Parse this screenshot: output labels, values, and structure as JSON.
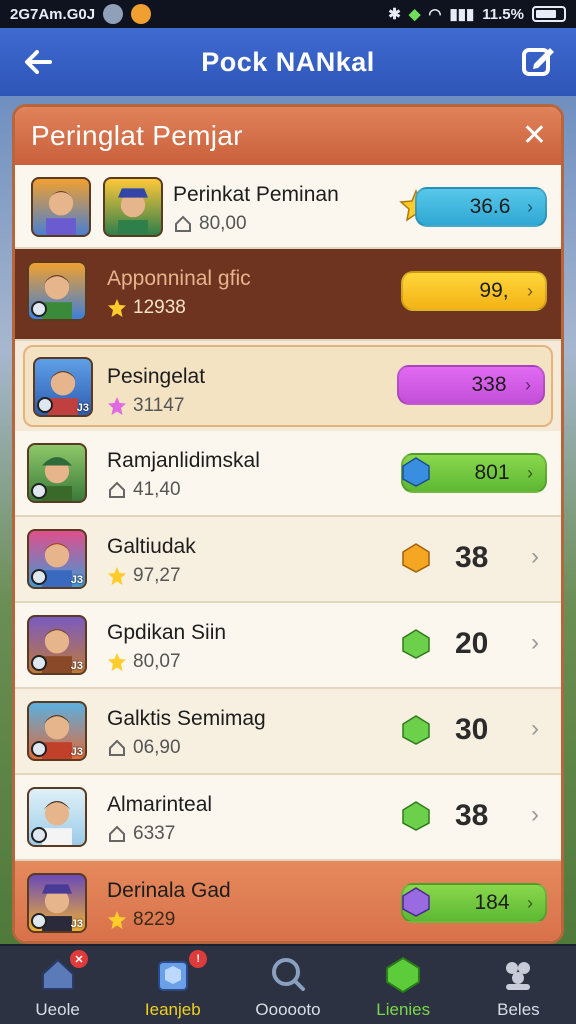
{
  "status_bar": {
    "time": "2G7Am.G0J",
    "battery": "11.5%"
  },
  "app_bar": {
    "title": "Pock NANkal"
  },
  "panel": {
    "title": "Peringlat Pemjar",
    "close": "✕"
  },
  "rows": [
    {
      "name": "Perinkat Peminan",
      "sub_value": "80,00",
      "sub_icon": "house-icon",
      "badge": "",
      "value": "36.6",
      "value_style": "pill-teal",
      "gem": "star-gem"
    },
    {
      "name": "Apponninal gfic",
      "sub_value": "12938",
      "sub_icon": "star-icon",
      "badge": "",
      "value": "99,",
      "value_style": "pill-yellow",
      "gem": "pink-gem"
    },
    {
      "name": "Pesingelat",
      "sub_value": "31147",
      "sub_icon": "pink-star-icon",
      "badge": "J3",
      "value": "338",
      "value_style": "pill-magenta",
      "gem": "blue-crystal-gem"
    },
    {
      "name": "Ramjanlidimskal",
      "sub_value": "41,40",
      "sub_icon": "house-icon",
      "badge": "",
      "value": "801",
      "value_style": "pill-green",
      "gem": "blue-gem"
    },
    {
      "name": "Galtiudak",
      "sub_value": "97,27",
      "sub_icon": "star-icon",
      "badge": "J3",
      "value": "38",
      "value_style": "plain",
      "gem": "orange-gem"
    },
    {
      "name": "Gpdikan Siin",
      "sub_value": "80,07",
      "sub_icon": "star-icon",
      "badge": "J3",
      "value": "20",
      "value_style": "plain",
      "gem": "green-gem"
    },
    {
      "name": "Galktis Semimag",
      "sub_value": "06,90",
      "sub_icon": "house-icon",
      "badge": "J3",
      "value": "30",
      "value_style": "plain",
      "gem": "green-gem"
    },
    {
      "name": "Almarinteal",
      "sub_value": "6337",
      "sub_icon": "house-icon",
      "badge": "",
      "value": "38",
      "value_style": "plain",
      "gem": "green-gem"
    },
    {
      "name": "Derinala Gad",
      "sub_value": "8229",
      "sub_icon": "star-icon",
      "badge": "J3",
      "value": "184",
      "value_style": "pill-green",
      "gem": "purple-gem"
    }
  ],
  "bottom_nav": [
    {
      "label": "Ueole",
      "icon": "house-icon"
    },
    {
      "label": "Ieanjeb",
      "icon": "crystal-box-icon"
    },
    {
      "label": "Oooooto",
      "icon": "search-icon"
    },
    {
      "label": "Lienies",
      "icon": "green-gem-icon"
    },
    {
      "label": "Beles",
      "icon": "people-icon"
    }
  ],
  "colors": {
    "app_bar": "#3f6ad0",
    "panel_header": "#d8704a",
    "pill_teal": "#2fa8d4",
    "pill_yellow": "#f3b315",
    "pill_magenta": "#c34fd8",
    "pill_green": "#5db833"
  }
}
